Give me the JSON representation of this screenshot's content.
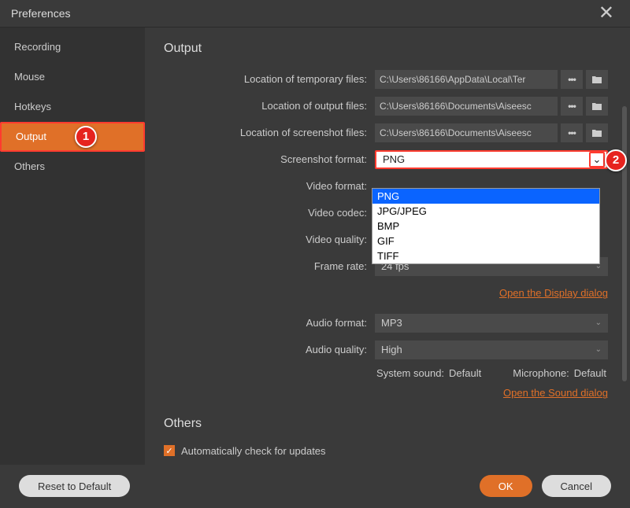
{
  "title": "Preferences",
  "sidebar": {
    "items": [
      {
        "label": "Recording"
      },
      {
        "label": "Mouse"
      },
      {
        "label": "Hotkeys"
      },
      {
        "label": "Output"
      },
      {
        "label": "Others"
      }
    ],
    "active_index": 3
  },
  "output": {
    "heading": "Output",
    "labels": {
      "temp": "Location of temporary files:",
      "out": "Location of output files:",
      "shot": "Location of screenshot files:",
      "sfmt": "Screenshot format:",
      "vfmt": "Video format:",
      "vcodec": "Video codec:",
      "vqual": "Video quality:",
      "frate": "Frame rate:",
      "afmt": "Audio format:",
      "aqual": "Audio quality:",
      "sys": "System sound:",
      "mic": "Microphone:"
    },
    "values": {
      "temp": "C:\\Users\\86166\\AppData\\Local\\Ter",
      "out": "C:\\Users\\86166\\Documents\\Aiseesc",
      "shot": "C:\\Users\\86166\\Documents\\Aiseesc",
      "sfmt": "PNG",
      "frate": "24 fps",
      "afmt": "MP3",
      "aqual": "High",
      "sys": "Default",
      "mic": "Default"
    },
    "sfmt_options": [
      "PNG",
      "JPG/JPEG",
      "BMP",
      "GIF",
      "TIFF"
    ],
    "links": {
      "display": "Open the Display dialog",
      "sound": "Open the Sound dialog"
    }
  },
  "others": {
    "heading": "Others",
    "autocheck": "Automatically check for updates"
  },
  "buttons": {
    "reset": "Reset to Default",
    "ok": "OK",
    "cancel": "Cancel"
  },
  "callouts": {
    "c1": "1",
    "c2": "2"
  }
}
